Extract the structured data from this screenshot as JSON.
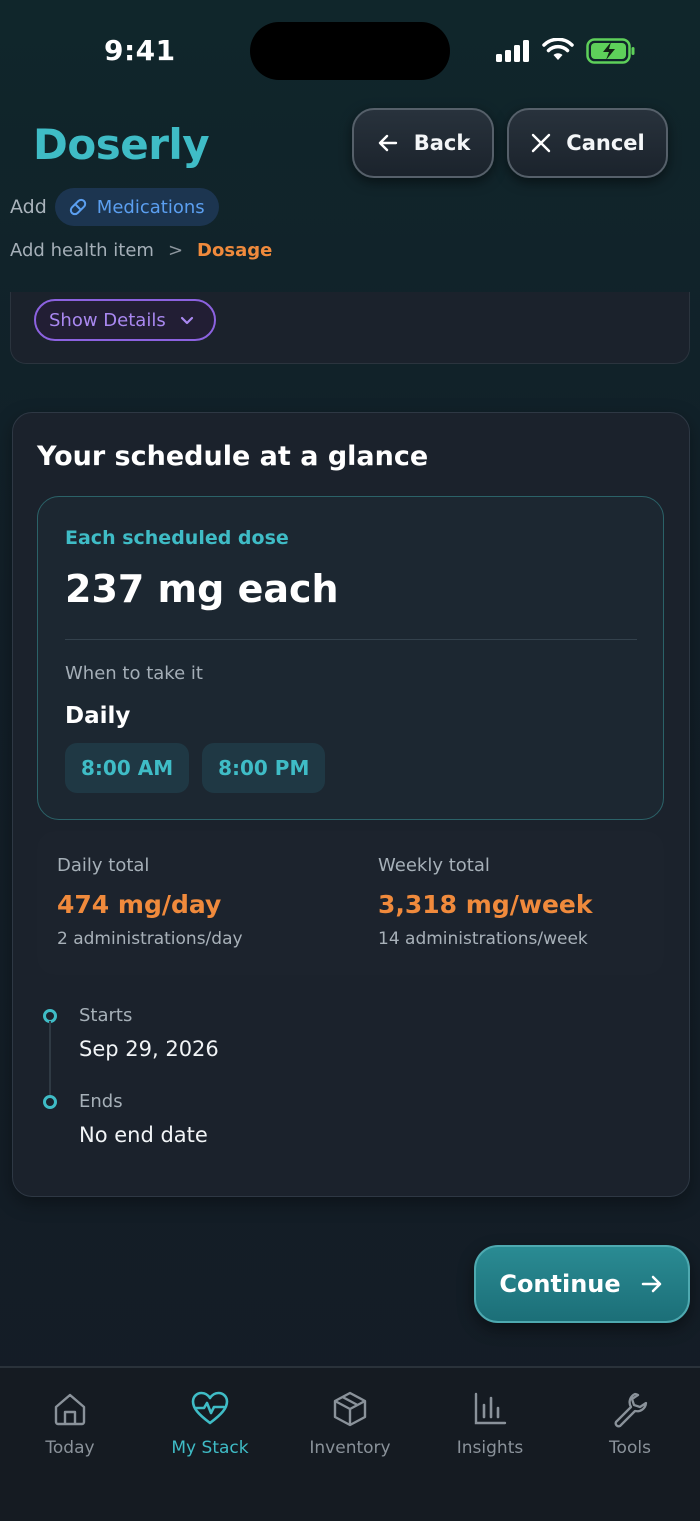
{
  "status": {
    "time": "9:41"
  },
  "header": {
    "app_title": "Doserly",
    "back_label": "Back",
    "cancel_label": "Cancel",
    "add_label": "Add",
    "category_chip": "Medications"
  },
  "breadcrumb": {
    "step1": "Add health item",
    "separator": ">",
    "step2": "Dosage"
  },
  "details": {
    "show_details_label": "Show Details"
  },
  "schedule": {
    "title": "Your schedule at a glance",
    "dose_label": "Each scheduled dose",
    "dose_value": "237 mg each",
    "when_label": "When to take it",
    "frequency": "Daily",
    "times": [
      "8:00 AM",
      "8:00 PM"
    ],
    "daily_total_label": "Daily total",
    "daily_total_value": "474 mg/day",
    "daily_total_sub": "2 administrations/day",
    "weekly_total_label": "Weekly total",
    "weekly_total_value": "3,318 mg/week",
    "weekly_total_sub": "14 administrations/week",
    "starts_label": "Starts",
    "starts_value": "Sep 29, 2026",
    "ends_label": "Ends",
    "ends_value": "No end date"
  },
  "actions": {
    "continue_label": "Continue"
  },
  "tabs": [
    {
      "label": "Today",
      "icon": "home-icon",
      "active": false
    },
    {
      "label": "My Stack",
      "icon": "heart-pulse-icon",
      "active": true
    },
    {
      "label": "Inventory",
      "icon": "box-icon",
      "active": false
    },
    {
      "label": "Insights",
      "icon": "bar-chart-icon",
      "active": false
    },
    {
      "label": "Tools",
      "icon": "wrench-icon",
      "active": false
    }
  ],
  "colors": {
    "accent": "#3fbcc6",
    "orange": "#f08a3c",
    "purple": "#8c62e0",
    "blue": "#5b9ff0"
  }
}
